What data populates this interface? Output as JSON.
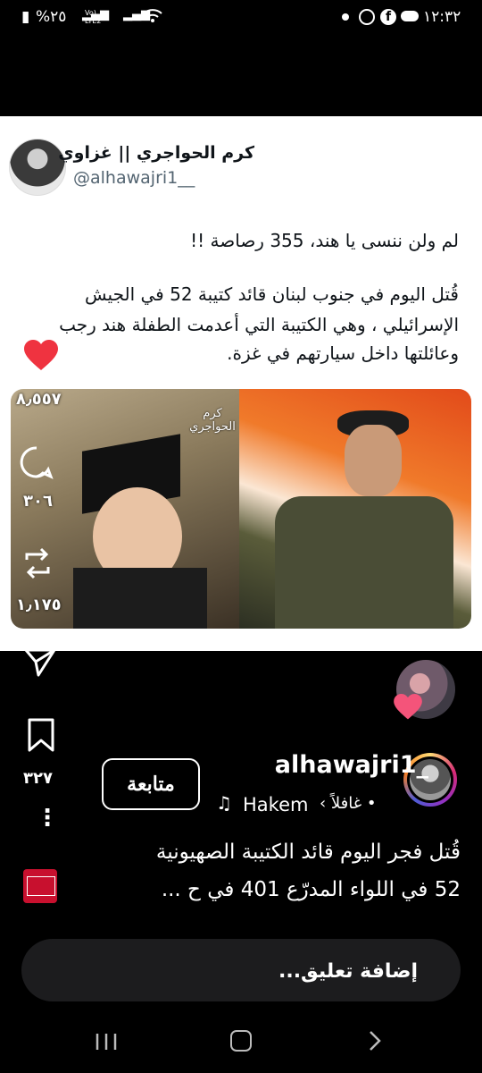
{
  "status_bar": {
    "time": "١٢:٣٢",
    "battery": "%٢٥",
    "network": "Vo) LTE2"
  },
  "tweet": {
    "display_name": "كرم الحواجري || غزاوي",
    "handle": "@alhawajri1__",
    "line1": "لم ولن ننسى يا هند، 355 رصاصة !!",
    "line2": "قُتل اليوم في جنوب لبنان قائد كتيبة 52 في الجيش",
    "line3": "الإسرائيلي ، وهي الكتيبة التي أعدمت الطفلة هند رجب",
    "line4": "وعائلتها داخل سيارتهم في غزة.",
    "watermark": "كرم\nالحواجري"
  },
  "actions": {
    "likes": "٨٫٥٥٧",
    "comments": "٣٠٦",
    "reposts": "١٫١٧٥",
    "saves": "٣٢٧"
  },
  "reel": {
    "username": "alhawajri1_",
    "follow_label": "متابعة",
    "audio": "Hakem",
    "audio_sep": "• غافلاً ›",
    "caption1": "قُتل فجر اليوم قائد الكتيبة الصهيونية",
    "caption2": "52 في اللواء المدرّع 401 في ح ...",
    "comment_placeholder": "إضافة تعليق..."
  },
  "colors": {
    "heart": "#ef3340",
    "background": "#000000",
    "card": "#ffffff"
  },
  "icons": [
    "heart-icon",
    "comment-icon",
    "repost-icon",
    "send-icon",
    "bookmark-icon",
    "more-icon",
    "music-note-icon",
    "recents-icon",
    "home-icon",
    "back-icon"
  ]
}
